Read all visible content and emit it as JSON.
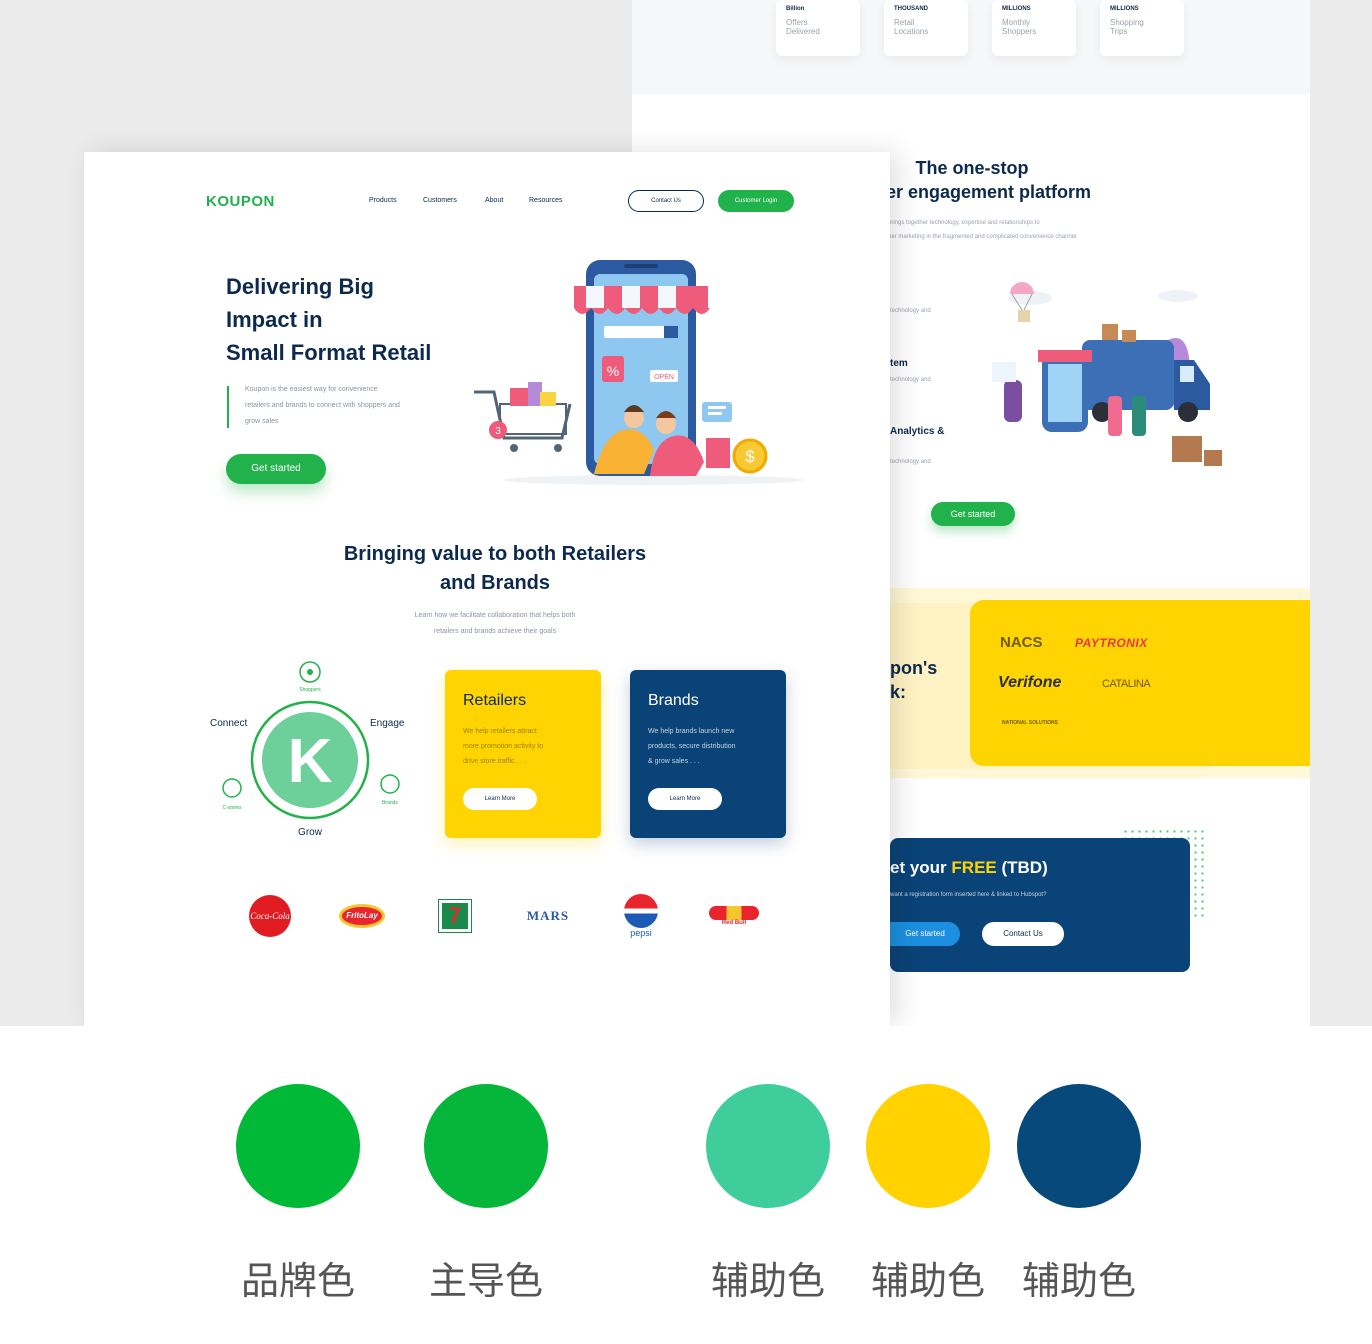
{
  "back_page": {
    "stats": [
      {
        "unit": "Billion",
        "label1": "Offers",
        "label2": "Delivered"
      },
      {
        "unit": "THOUSAND",
        "label1": "Retail",
        "label2": "Locations"
      },
      {
        "unit": "MILLIONS",
        "label1": "Monthly",
        "label2": "Shoppers"
      },
      {
        "unit": "MILLIONS",
        "label1": "Shopping",
        "label2": "Trips"
      }
    ],
    "title_line1": "The one-stop",
    "title_line2": "er engagement platform",
    "subtitle_line1": "brings together technology, expertise and relationships to",
    "subtitle_line2": "per marketing in the fragmented and complicated convenience channel",
    "list": [
      {
        "title": "",
        "sub": "technology and"
      },
      {
        "title": "tem",
        "sub": "technology and"
      },
      {
        "title": "Analytics &",
        "sub": "technology and"
      }
    ],
    "cta": "Get started",
    "heading_fragment_1": "pon's",
    "heading_fragment_2": "k:",
    "partners": [
      "NACS",
      "PAYTRONIX",
      "Verifone",
      "CATALINA",
      "NATIONAL SOLUTIONS"
    ],
    "banner": {
      "title_pre": "et your ",
      "title_free": "FREE",
      "title_post": " (TBD)",
      "sub": "want a registration form inserted here & linked to Hubspot?",
      "btn_primary": "Get started",
      "btn_secondary": "Contact Us"
    }
  },
  "front_page": {
    "logo": "KOUPON",
    "nav": [
      "Products",
      "Customers",
      "About",
      "Resources"
    ],
    "contact_button": "Contact Us",
    "login_button": "Customer Login",
    "hero": {
      "title_line1": "Delivering Big",
      "title_line2": "Impact in",
      "title_line3": "Small Format Retail",
      "subtitle_line1": "Koupon is the easiest way for convenience",
      "subtitle_line2": "retailers and brands to connect with shoppers and",
      "subtitle_line3": "grow sales",
      "cta": "Get started",
      "badge_percent": "%",
      "badge_open": "OPEN",
      "badge_number": "3",
      "badge_dollar": "$"
    },
    "section": {
      "title_line1": "Bringing value to both Retailers",
      "title_line2": "and Brands",
      "subtitle_line1": "Learn how we facilitate collaboration that helps both",
      "subtitle_line2": "retailers and brands achieve their goals"
    },
    "cycle": {
      "connect": "Connect",
      "engage": "Engage",
      "grow": "Grow",
      "shoppers": "Shoppers",
      "brands": "Brands",
      "c_stores": "C-stores",
      "center": "K"
    },
    "cards": [
      {
        "title": "Retailers",
        "line1": "We help retailers attract",
        "line2": "more promotion activity to",
        "line3": "drive store traffic . . .",
        "button": "Learn More"
      },
      {
        "title": "Brands",
        "line1": "We help brands launch new",
        "line2": "products, secure distribution",
        "line3": "& grow sales . . .",
        "button": "Learn More"
      }
    ],
    "brand_logos": [
      "Coca-Cola",
      "FritoLay",
      "7",
      "MARS",
      "pepsi",
      "Red Bull"
    ]
  },
  "swatches": [
    {
      "color": "#00b936",
      "label": "品牌色"
    },
    {
      "color": "#05b63a",
      "label": "主导色"
    },
    {
      "color": "#3ecd9b",
      "label": "辅助色"
    },
    {
      "color": "#ffd200",
      "label": "辅助色"
    },
    {
      "color": "#08497b",
      "label": "辅助色"
    }
  ]
}
